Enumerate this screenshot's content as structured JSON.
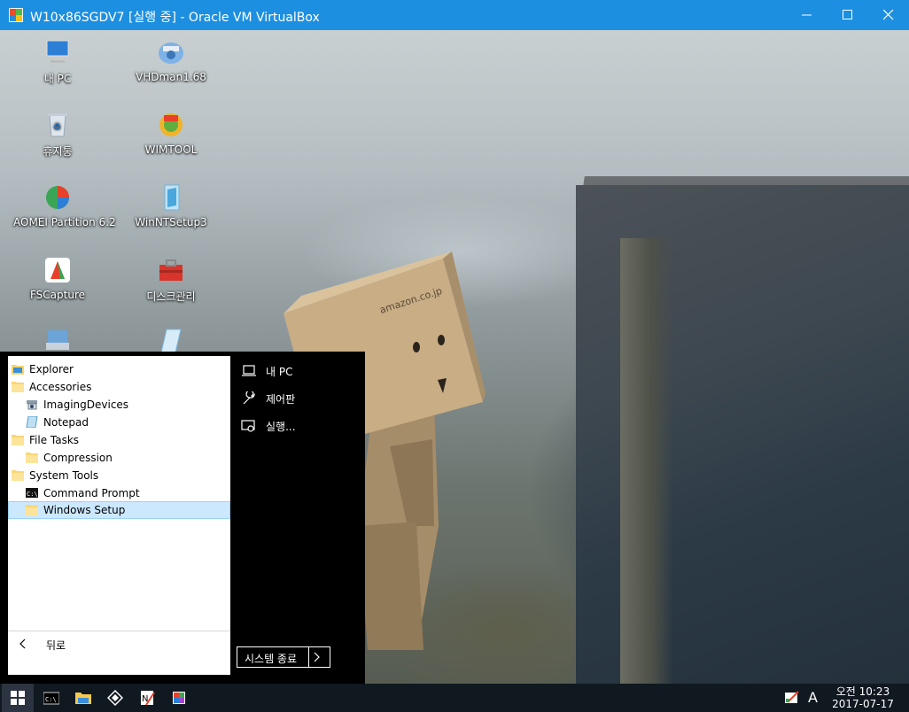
{
  "window": {
    "title": "W10x86SGDV7 [실행 중] - Oracle VM VirtualBox"
  },
  "desktop_icons": [
    {
      "label": "내 PC",
      "icon": "computer-icon"
    },
    {
      "label": "VHDman1.68",
      "icon": "disk-tool-icon"
    },
    {
      "label": "휴지통",
      "icon": "recycle-bin-icon"
    },
    {
      "label": "WIMTOOL",
      "icon": "wim-tool-icon"
    },
    {
      "label": "AOMEI Partition 6.2",
      "icon": "partition-icon"
    },
    {
      "label": "WinNTSetup3",
      "icon": "setup-icon"
    },
    {
      "label": "FSCapture",
      "icon": "capture-icon"
    },
    {
      "label": "디스크관리",
      "icon": "toolbox-icon"
    }
  ],
  "start_menu": {
    "tree": [
      {
        "label": "Explorer",
        "icon": "explorer-folder-icon",
        "selected": false
      },
      {
        "label": "Accessories",
        "icon": "folder-icon",
        "selected": false
      },
      {
        "label": "ImagingDevices",
        "icon": "scanner-icon",
        "selected": false
      },
      {
        "label": "Notepad",
        "icon": "notepad-icon",
        "selected": false
      },
      {
        "label": "File Tasks",
        "icon": "folder-icon",
        "selected": false
      },
      {
        "label": "Compression",
        "icon": "folder-icon",
        "selected": false
      },
      {
        "label": "System Tools",
        "icon": "folder-icon",
        "selected": false
      },
      {
        "label": "Command Prompt",
        "icon": "cmd-icon",
        "selected": false
      },
      {
        "label": "Windows Setup",
        "icon": "folder-icon",
        "selected": true
      }
    ],
    "back_label": "뒤로",
    "right_items": [
      {
        "label": "내 PC",
        "icon": "laptop-icon"
      },
      {
        "label": "제어판",
        "icon": "wrench-icon"
      },
      {
        "label": "실행...",
        "icon": "run-icon"
      }
    ],
    "shutdown_label": "시스템 종료"
  },
  "taskbar": {
    "ime_indicator": "A",
    "clock_time": "오전 10:23",
    "clock_date": "2017-07-17"
  },
  "colors": {
    "titlebar": "#1d8fe0",
    "selection": "#cce8ff",
    "taskbar": "#101820"
  }
}
